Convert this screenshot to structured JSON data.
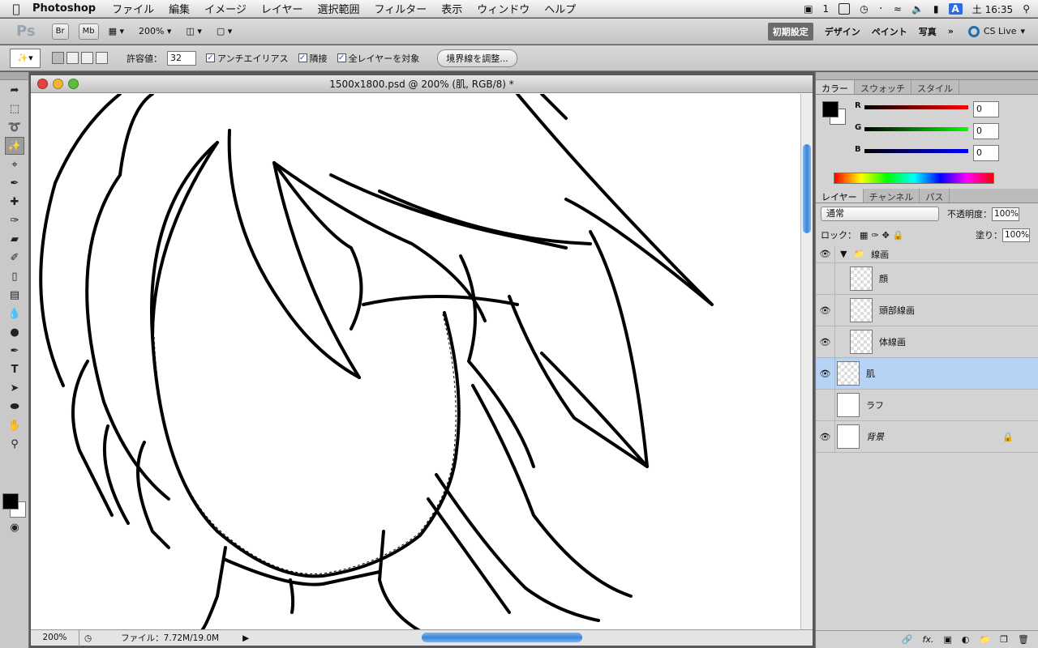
{
  "menubar": {
    "app": "Photoshop",
    "items": [
      "ファイル",
      "編集",
      "イメージ",
      "レイヤー",
      "選択範囲",
      "フィルター",
      "表示",
      "ウィンドウ",
      "ヘルプ"
    ],
    "status_num": "1",
    "input_badge": "A",
    "clock": "土 16:35"
  },
  "appbar": {
    "logo": "Ps",
    "br": "Br",
    "mb": "Mb",
    "zoom": "200%",
    "workspaces": [
      "初期設定",
      "デザイン",
      "ペイント",
      "写真"
    ],
    "more": "»",
    "cslive": "CS Live"
  },
  "options": {
    "tolerance_label": "許容値：",
    "tolerance_value": "32",
    "antialias": "アンチエイリアス",
    "contiguous": "隣接",
    "all_layers": "全レイヤーを対象",
    "refine_edge": "境界線を調整..."
  },
  "document": {
    "title": "1500x1800.psd @ 200% (肌, RGB/8) *",
    "zoom": "200%",
    "file_info": "ファイル：7.72M/19.0M"
  },
  "color_panel": {
    "tabs": [
      "カラー",
      "スウォッチ",
      "スタイル"
    ],
    "r_label": "R",
    "g_label": "G",
    "b_label": "B",
    "r": "0",
    "g": "0",
    "b": "0"
  },
  "layers_panel": {
    "tabs": [
      "レイヤー",
      "チャンネル",
      "パス"
    ],
    "blend_mode": "通常",
    "opacity_label": "不透明度：",
    "opacity": "100%",
    "lock_label": "ロック：",
    "fill_label": "塗り：",
    "fill": "100%",
    "group": "線画",
    "layers": [
      {
        "name": "顔",
        "visible": false
      },
      {
        "name": "頭部線画",
        "visible": true
      },
      {
        "name": "体線画",
        "visible": true
      },
      {
        "name": "肌",
        "visible": true,
        "selected": true
      },
      {
        "name": "ラフ",
        "visible": false
      },
      {
        "name": "背景",
        "visible": true,
        "locked": true
      }
    ]
  }
}
